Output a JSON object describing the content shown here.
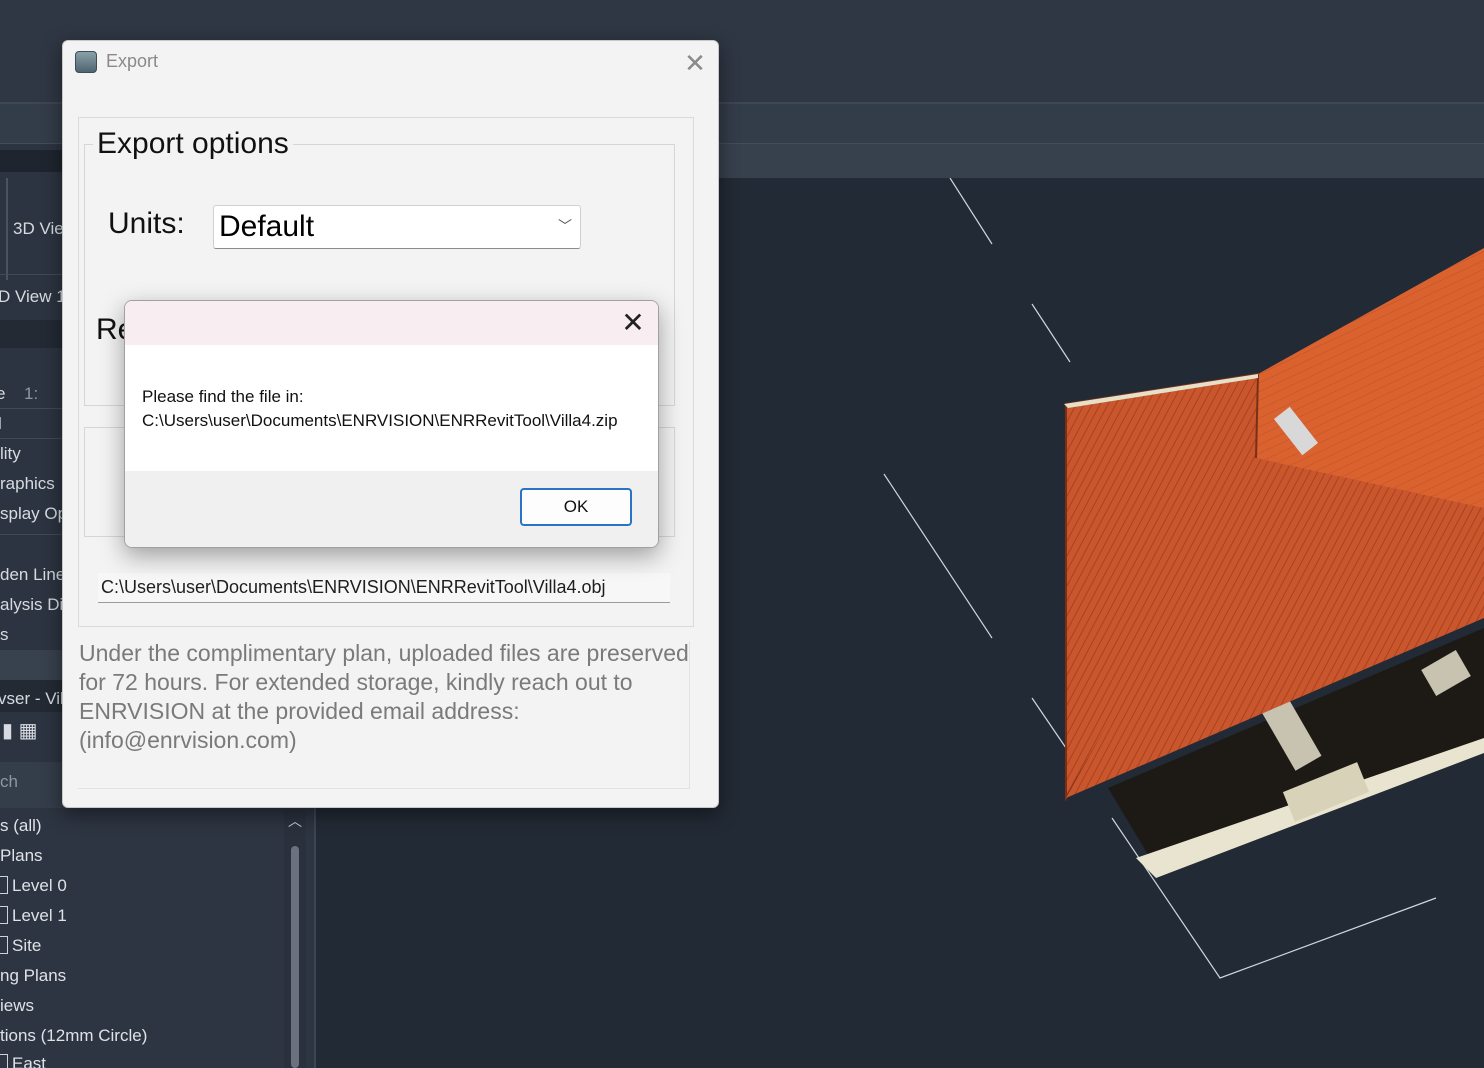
{
  "background_app": {
    "left_panel": {
      "view_tab": "3D Vie",
      "view_item": "D View 1",
      "properties_rows": [
        "e",
        "1:",
        "l",
        "lity",
        "raphics ",
        "splay Op",
        "den Lines",
        "alysis Di",
        "s"
      ],
      "browser_title": "vser - Vil",
      "search_placeholder": "ch"
    },
    "project_browser": {
      "items": [
        {
          "label": "s (all)",
          "has_icon": false
        },
        {
          "label": " Plans",
          "has_icon": false
        },
        {
          "label": "Level 0",
          "has_icon": true
        },
        {
          "label": "Level 1",
          "has_icon": true
        },
        {
          "label": "Site",
          "has_icon": true
        },
        {
          "label": "ng Plans",
          "has_icon": false
        },
        {
          "label": "iews",
          "has_icon": false
        },
        {
          "label": "tions (12mm Circle)",
          "has_icon": false
        },
        {
          "label": "East",
          "has_icon": true
        }
      ]
    },
    "viewport": {
      "roof_color": "#c2502a",
      "background_color": "#222a35"
    }
  },
  "export_dialog": {
    "title": "Export",
    "options_title": "Export options",
    "units_label": "Units:",
    "units_value": "Default",
    "re_label": "Re",
    "file_path": "C:\\Users\\user\\Documents\\ENRVISION\\ENRRevitTool\\Villa4.obj",
    "note": "Under the complimentary plan, uploaded files are preserved for 72 hours. For extended storage, kindly reach out to ENRVISION at the provided email address: (info@enrvision.com)"
  },
  "message_box": {
    "line1": "Please find the file in:",
    "line2": "C:\\Users\\user\\Documents\\ENRVISION\\ENRRevitTool\\Villa4.zip",
    "ok_label": "OK",
    "ok_border_color": "#2a73c5"
  }
}
